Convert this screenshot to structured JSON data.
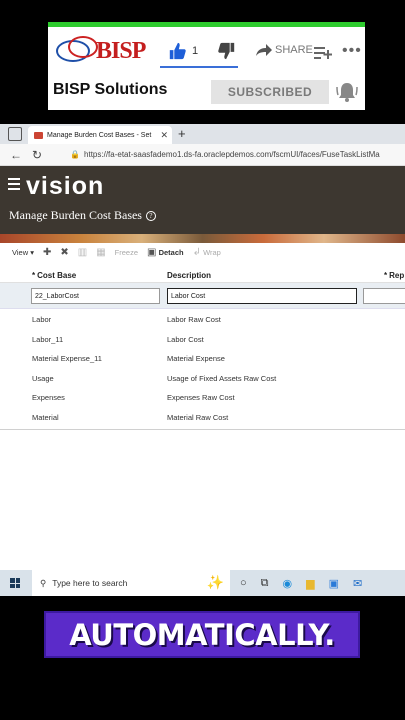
{
  "banner": {
    "logo_text": "BISP",
    "like_count": "1",
    "share_label": "SHARE",
    "channel_name": "BISP Solutions",
    "subscribed_label": "SUBSCRIBED",
    "colors": {
      "green_bar": "#2ecc2e",
      "like_blue": "#3a6fd8",
      "logo_red": "#c41e1e"
    }
  },
  "browser": {
    "tab_title": "Manage Burden Cost Bases - Set",
    "url": "https://fa-etat-saasfademo1.ds-fa.oraclepdemos.com/fscmUI/faces/FuseTaskListMa"
  },
  "app": {
    "logo": "vision",
    "page_title": "Manage Burden Cost Bases",
    "header_color": "#3d3730"
  },
  "toolbar": {
    "view_label": "View",
    "freeze_label": "Freeze",
    "detach_label": "Detach",
    "wrap_label": "Wrap"
  },
  "table": {
    "columns": [
      "Cost Base",
      "Description",
      "Rep"
    ],
    "edit_row": {
      "cost_base": "22_LaborCost",
      "description": "Labor Cost"
    },
    "rows": [
      {
        "cost_base": "Labor",
        "description": "Labor Raw Cost"
      },
      {
        "cost_base": "Labor_11",
        "description": "Labor Cost"
      },
      {
        "cost_base": "Material Expense_11",
        "description": "Material Expense"
      },
      {
        "cost_base": "Usage",
        "description": "Usage of Fixed Assets Raw Cost"
      },
      {
        "cost_base": "Expenses",
        "description": "Expenses Raw Cost"
      },
      {
        "cost_base": "Material",
        "description": "Material Raw Cost"
      }
    ]
  },
  "taskbar": {
    "search_placeholder": "Type here to search"
  },
  "caption": {
    "text": "AUTOMATICALLY.",
    "bg_color": "#5b2bc9"
  }
}
